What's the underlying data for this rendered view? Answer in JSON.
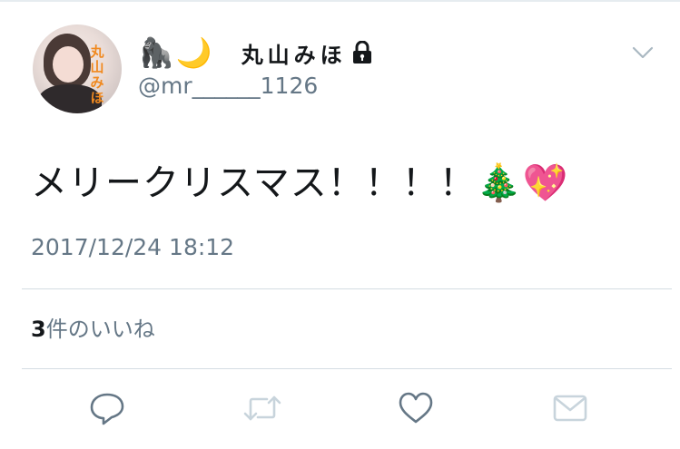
{
  "profile": {
    "display_name": "丸山みほ",
    "name_emoji": "🦍🌙",
    "handle": "@mr______1126",
    "avatar_text": "丸山みほ",
    "protected": true
  },
  "tweet": {
    "text": "メリークリスマス！！！！",
    "emoji": "🎄💖",
    "timestamp": "2017/12/24 18:12"
  },
  "likes": {
    "count": "3",
    "label": "件のいいね"
  },
  "actions": {
    "reply": "reply-icon",
    "retweet": "retweet-icon",
    "like": "heart-icon",
    "dm": "envelope-icon"
  },
  "colors": {
    "text": "#14171a",
    "secondary": "#657786",
    "action_icon": "#657786",
    "retweet_disabled": "#c8d4dc",
    "divider": "#d4dde3",
    "avatar_text": "#f0891f"
  }
}
